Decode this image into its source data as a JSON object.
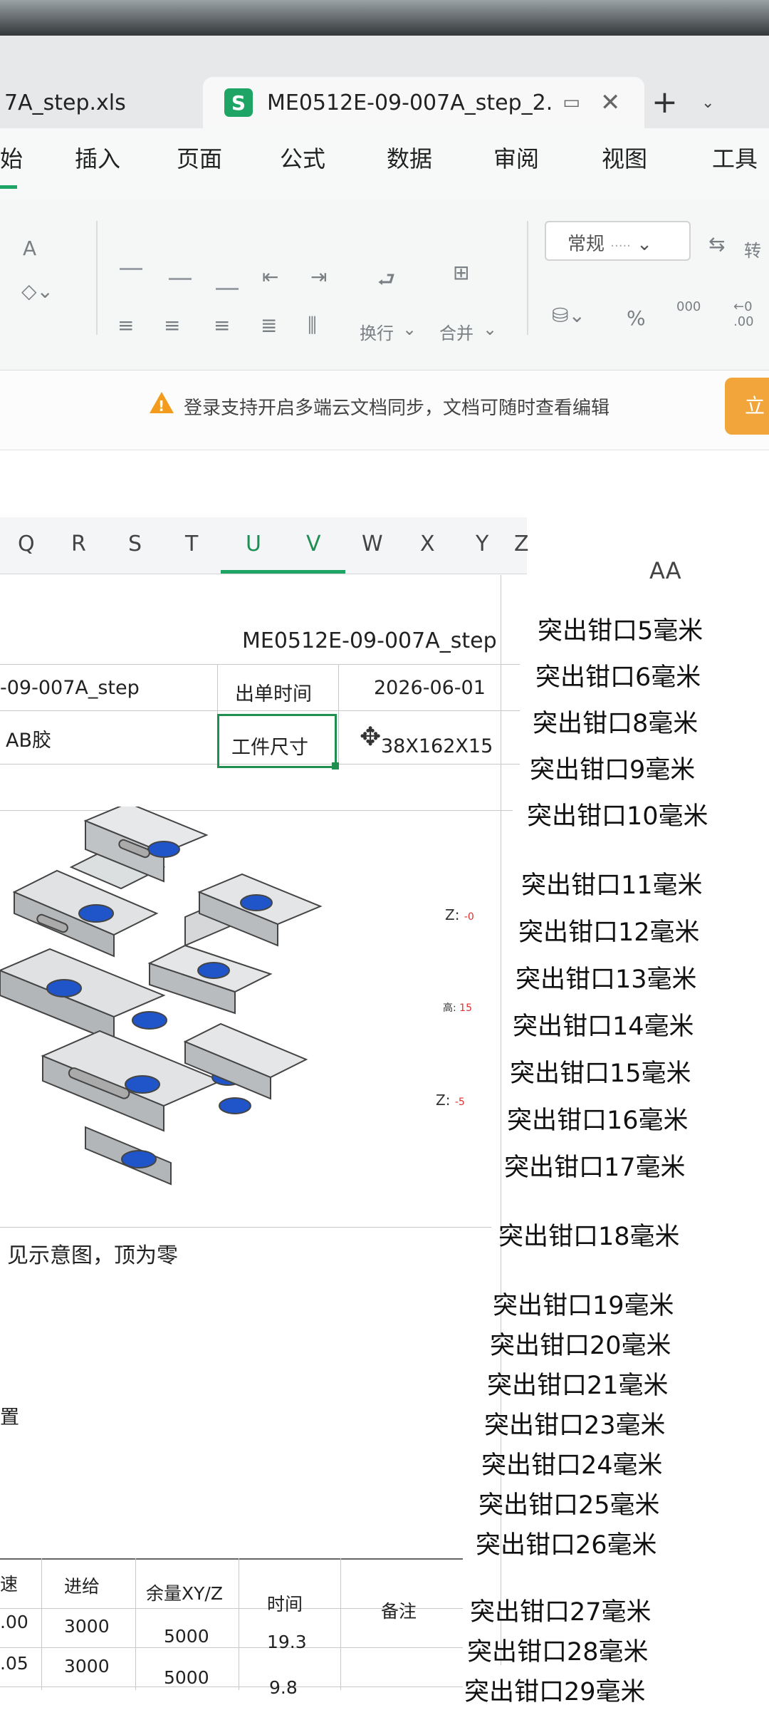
{
  "tabs": [
    {
      "label": "7A_step.xls"
    },
    {
      "label": "ME0512E-09-007A_step_2.",
      "icon": "S"
    }
  ],
  "menu": [
    "始",
    "插入",
    "页面",
    "公式",
    "数据",
    "审阅",
    "视图",
    "工具"
  ],
  "ribbon": {
    "number_format": "常规",
    "number_format_dots": "·····",
    "wrap_label": "换行",
    "merge_label": "合并",
    "convert_label": "转",
    "percent": "%",
    "thousands": "000",
    "decimals": "←0\n.00",
    "font_a": "A"
  },
  "notice": {
    "text": "登录支持开启多端云文档同步，文档可随时查看编辑",
    "button": "立"
  },
  "columns": [
    "Q",
    "R",
    "S",
    "T",
    "U",
    "V",
    "W",
    "X",
    "Y",
    "Z"
  ],
  "col_aa": "AA",
  "cells": {
    "title": "ME0512E-09-007A_step",
    "file_ref": "-09-007A_step",
    "order_time_label": "出单时间",
    "order_time_value": "2026-06-01",
    "material": "AB胶",
    "size_label": "工件尺寸",
    "size_value": "38X162X15",
    "note": "见示意图，顶为零",
    "note2": "置"
  },
  "markers": {
    "z1": "Z:",
    "z1v": "-0",
    "h": "高:",
    "hv": "15",
    "z2": "Z:",
    "z2v": "-5"
  },
  "aa_items": [
    "突出钳口5毫米",
    "突出钳口6毫米",
    "突出钳口8毫米",
    "突出钳口9毫米",
    "突出钳口10毫米",
    "突出钳口11毫米",
    "突出钳口12毫米",
    "突出钳口13毫米",
    "突出钳口14毫米",
    "突出钳口15毫米",
    "突出钳口16毫米",
    "突出钳口17毫米",
    "突出钳口18毫米",
    "突出钳口19毫米",
    "突出钳口20毫米",
    "突出钳口21毫米",
    "突出钳口23毫米",
    "突出钳口24毫米",
    "突出钳口25毫米",
    "突出钳口26毫米",
    "突出钳口27毫米",
    "突出钳口28毫米",
    "突出钳口29毫米"
  ],
  "table": {
    "headers": [
      "速",
      "进给",
      "余量XY/Z",
      "时间",
      "备注"
    ],
    "rows": [
      [
        ".00",
        "3000",
        "5000",
        "19.3",
        ""
      ],
      [
        ".05",
        "3000",
        "5000",
        "9.8",
        ""
      ]
    ]
  },
  "colors": {
    "accent": "#1ea566",
    "warning": "#f29b1d",
    "part_hole": "#1f55c8"
  }
}
